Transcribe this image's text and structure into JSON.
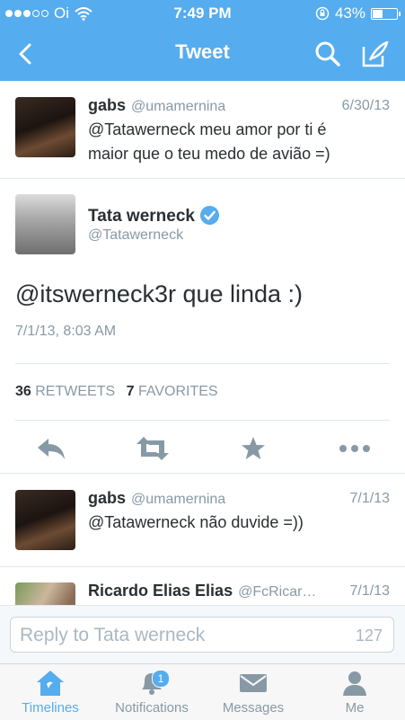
{
  "status_bar": {
    "carrier": "Oi",
    "time": "7:49 PM",
    "battery": "43%",
    "battery_level": 0.43
  },
  "nav": {
    "title": "Tweet",
    "icons": [
      "back-icon",
      "search-icon",
      "compose-icon"
    ]
  },
  "parent_tweet": {
    "name": "gabs",
    "handle": "@umamernina",
    "date": "6/30/13",
    "text_line1": "@Tatawerneck meu amor por ti é",
    "text_line2": "maior que o teu medo de avião =)"
  },
  "main_tweet": {
    "name": "Tata werneck",
    "handle": "@Tatawerneck",
    "text": "@itswerneck3r que linda :)",
    "timestamp": "7/1/13, 8:03 AM",
    "retweets_count": "36",
    "retweets_label": "RETWEETS",
    "favorites_count": "7",
    "favorites_label": "FAVORITES",
    "actions": [
      "reply-icon",
      "retweet-icon",
      "favorite-icon",
      "more-icon"
    ]
  },
  "replies": [
    {
      "name": "gabs",
      "handle": "@umamernina",
      "date": "7/1/13",
      "text": "@Tatawerneck não duvide =))"
    },
    {
      "name": "Ricardo Elias Elias",
      "handle": "@FcRicar…",
      "date": "7/1/13"
    }
  ],
  "reply_box": {
    "placeholder": "Reply to Tata werneck",
    "count": "127"
  },
  "tab_bar": {
    "tabs": [
      {
        "label": "Timelines",
        "icon": "home-icon",
        "active": true
      },
      {
        "label": "Notifications",
        "icon": "bell-icon",
        "badge": "1"
      },
      {
        "label": "Messages",
        "icon": "envelope-icon"
      },
      {
        "label": "Me",
        "icon": "person-icon"
      }
    ]
  },
  "colors": {
    "accent": "#55acee",
    "muted": "#8899a6",
    "text": "#292f33"
  }
}
